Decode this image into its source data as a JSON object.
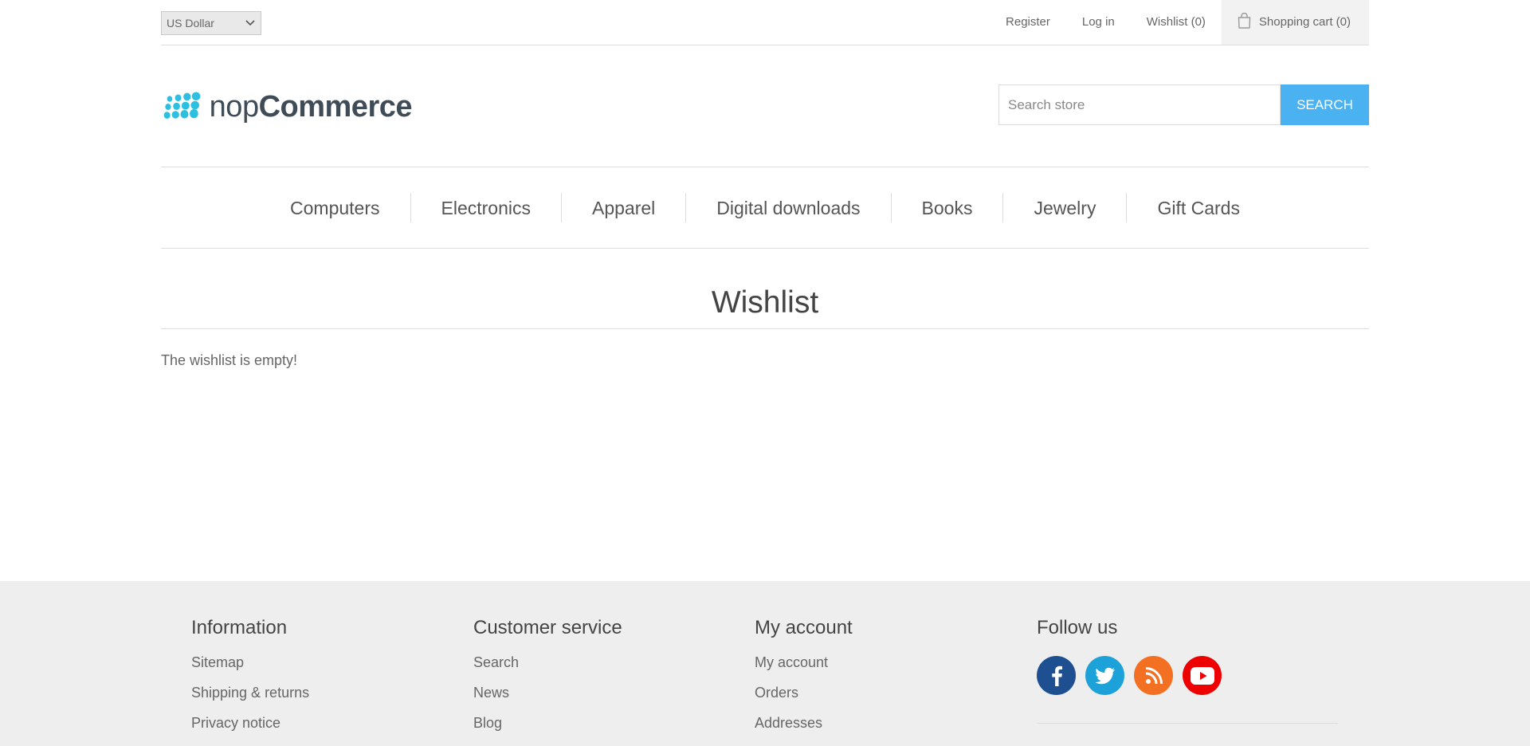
{
  "header": {
    "currency": "US Dollar",
    "links": {
      "register": "Register",
      "login": "Log in",
      "wishlist": "Wishlist (0)",
      "cart": "Shopping cart (0)"
    }
  },
  "logo": {
    "text_light": "nop",
    "text_bold": "Commerce",
    "icon": "nopcommerce-dots-logo",
    "color": "#2cbfe0"
  },
  "search": {
    "placeholder": "Search store",
    "button": "Search"
  },
  "nav": {
    "items": [
      "Computers",
      "Electronics",
      "Apparel",
      "Digital downloads",
      "Books",
      "Jewelry",
      "Gift Cards"
    ]
  },
  "page": {
    "title": "Wishlist",
    "empty_message": "The wishlist is empty!"
  },
  "footer": {
    "information": {
      "title": "Information",
      "items": [
        "Sitemap",
        "Shipping & returns",
        "Privacy notice"
      ]
    },
    "customer_service": {
      "title": "Customer service",
      "items": [
        "Search",
        "News",
        "Blog"
      ]
    },
    "my_account": {
      "title": "My account",
      "items": [
        "My account",
        "Orders",
        "Addresses"
      ]
    },
    "follow_us": {
      "title": "Follow us",
      "networks": [
        {
          "name": "facebook-icon",
          "color": "#1d4f91"
        },
        {
          "name": "twitter-icon",
          "color": "#1da1d9"
        },
        {
          "name": "rss-icon",
          "color": "#f36f21"
        },
        {
          "name": "youtube-icon",
          "color": "#ee0000"
        }
      ]
    }
  },
  "colors": {
    "accent": "#4ab2f1",
    "footer_bg": "#eeeeee"
  }
}
